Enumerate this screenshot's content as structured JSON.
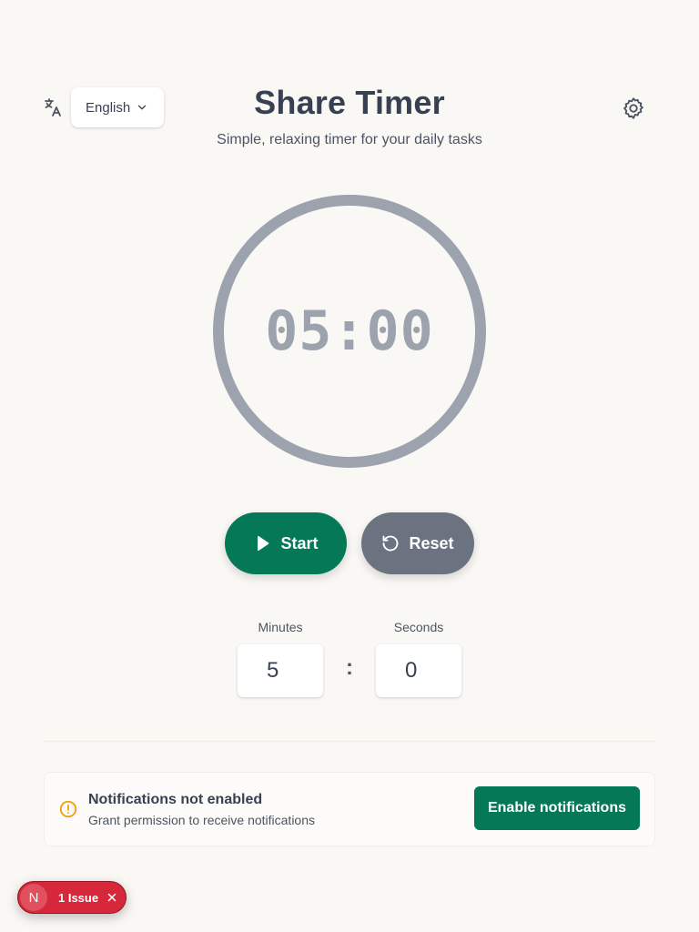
{
  "header": {
    "title": "Share Timer",
    "subtitle": "Simple, relaxing timer for your daily tasks",
    "language_selected": "English"
  },
  "timer": {
    "display": "05:00"
  },
  "controls": {
    "start_label": "Start",
    "reset_label": "Reset"
  },
  "inputs": {
    "minutes_label": "Minutes",
    "minutes_value": "5",
    "separator": ":",
    "seconds_label": "Seconds",
    "seconds_value": "0"
  },
  "notification": {
    "title": "Notifications not enabled",
    "description": "Grant permission to receive notifications",
    "button_label": "Enable notifications"
  },
  "dev_overlay": {
    "logo_letter": "N",
    "issue_label": "1 Issue"
  },
  "icons": {
    "language": "translate-icon",
    "dropdown": "chevron-down-icon",
    "settings": "gear-icon",
    "start": "play-icon",
    "reset": "rotate-ccw-icon",
    "warning": "alert-circle-icon",
    "close": "close-icon"
  },
  "colors": {
    "background": "#faf8f5",
    "primary": "#047857",
    "secondary": "#6b7280",
    "ring": "#9ca3af",
    "text": "#374151",
    "warning": "#f59e0b",
    "issue": "#d6283a"
  }
}
